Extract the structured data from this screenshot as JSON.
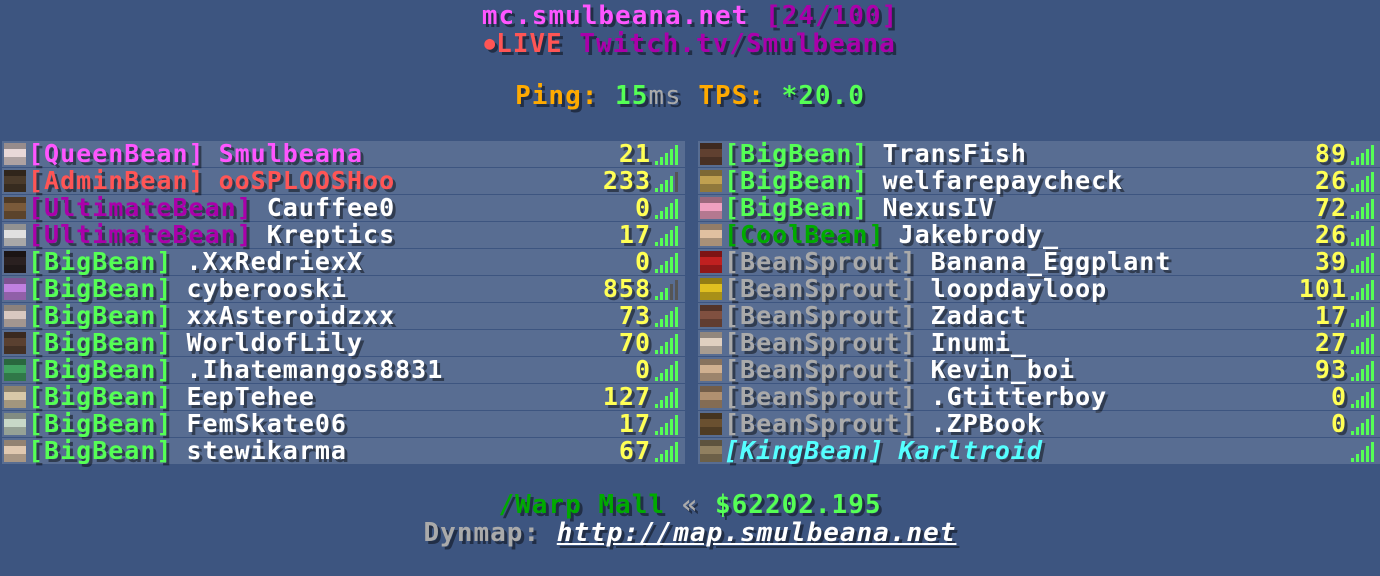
{
  "header": {
    "server": "mc.smulbeana.net",
    "count": "[24/100]",
    "live_dot": "●",
    "live": "LIVE",
    "twitch": "Twitch.tv/Smulbeana",
    "ping_label": "Ping:",
    "ping_value": "15",
    "ping_unit": "ms",
    "tps_label": "TPS:",
    "tps_value": "*20.0"
  },
  "colors": {
    "background": "#3d5580",
    "pink": "#ff55ff",
    "purple": "#aa00aa",
    "red": "#ff5555",
    "green": "#55ff55",
    "darkgreen": "#00aa00",
    "gray": "#aaaaaa",
    "aqua": "#55ffff",
    "gold": "#ffaa00",
    "yellow": "#ffff55"
  },
  "players_left": [
    {
      "rank": "[QueenBean]",
      "name": "Smulbeana",
      "ping": "21",
      "rank_color": "#ff55ff",
      "name_color": "#ff55ff",
      "head": "#e8d8d8",
      "signal": "full"
    },
    {
      "rank": "[AdminBean]",
      "name": "ooSPLOOSHoo",
      "ping": "233",
      "rank_color": "#ff5555",
      "name_color": "#ff5555",
      "head": "#4a3a2a",
      "signal": "weak2"
    },
    {
      "rank": "[UltimateBean]",
      "name": "Cauffee0",
      "ping": "0",
      "rank_color": "#aa00aa",
      "name_color": "#ffffff",
      "head": "#7a5a3a",
      "signal": "full"
    },
    {
      "rank": "[UltimateBean]",
      "name": "Kreptics",
      "ping": "17",
      "rank_color": "#aa00aa",
      "name_color": "#ffffff",
      "head": "#e0e0e0",
      "signal": "full"
    },
    {
      "rank": "[BigBean]",
      "name": ".XxRedriexX",
      "ping": "0",
      "rank_color": "#55ff55",
      "name_color": "#ffffff",
      "head": "#2a2020",
      "signal": "full"
    },
    {
      "rank": "[BigBean]",
      "name": "cyberooski",
      "ping": "858",
      "rank_color": "#55ff55",
      "name_color": "#ffffff",
      "head": "#c080e0",
      "signal": "weak"
    },
    {
      "rank": "[BigBean]",
      "name": "xxAsteroidzxx",
      "ping": "73",
      "rank_color": "#55ff55",
      "name_color": "#ffffff",
      "head": "#d8c8c0",
      "signal": "full"
    },
    {
      "rank": "[BigBean]",
      "name": "WorldofLily",
      "ping": "70",
      "rank_color": "#55ff55",
      "name_color": "#ffffff",
      "head": "#5a4030",
      "signal": "full"
    },
    {
      "rank": "[BigBean]",
      "name": ".Ihatemangos8831",
      "ping": "0",
      "rank_color": "#55ff55",
      "name_color": "#ffffff",
      "head": "#40a060",
      "signal": "full"
    },
    {
      "rank": "[BigBean]",
      "name": "EepTehee",
      "ping": "127",
      "rank_color": "#55ff55",
      "name_color": "#ffffff",
      "head": "#d8c8a8",
      "signal": "full"
    },
    {
      "rank": "[BigBean]",
      "name": "FemSkate06",
      "ping": "17",
      "rank_color": "#55ff55",
      "name_color": "#ffffff",
      "head": "#c8d8c8",
      "signal": "full"
    },
    {
      "rank": "[BigBean]",
      "name": "stewikarma",
      "ping": "67",
      "rank_color": "#55ff55",
      "name_color": "#ffffff",
      "head": "#e0c8b0",
      "signal": "full"
    }
  ],
  "players_right": [
    {
      "rank": "[BigBean]",
      "name": "TransFish",
      "ping": "89",
      "rank_color": "#55ff55",
      "name_color": "#ffffff",
      "head": "#604030",
      "signal": "full"
    },
    {
      "rank": "[BigBean]",
      "name": "welfarepaycheck",
      "ping": "26",
      "rank_color": "#55ff55",
      "name_color": "#ffffff",
      "head": "#c0a050",
      "signal": "full"
    },
    {
      "rank": "[BigBean]",
      "name": "NexusIV",
      "ping": "72",
      "rank_color": "#55ff55",
      "name_color": "#ffffff",
      "head": "#f0a0c0",
      "signal": "full"
    },
    {
      "rank": "[CoolBean]",
      "name": "Jakebrody_",
      "ping": "26",
      "rank_color": "#00aa00",
      "name_color": "#ffffff",
      "head": "#e0c0a0",
      "signal": "full"
    },
    {
      "rank": "[BeanSprout]",
      "name": "Banana_Eggplant",
      "ping": "39",
      "rank_color": "#aaaaaa",
      "name_color": "#ffffff",
      "head": "#c02020",
      "signal": "full"
    },
    {
      "rank": "[BeanSprout]",
      "name": "loopdayloop",
      "ping": "101",
      "rank_color": "#aaaaaa",
      "name_color": "#ffffff",
      "head": "#e0c020",
      "signal": "full"
    },
    {
      "rank": "[BeanSprout]",
      "name": "Zadact",
      "ping": "17",
      "rank_color": "#aaaaaa",
      "name_color": "#ffffff",
      "head": "#805040",
      "signal": "full"
    },
    {
      "rank": "[BeanSprout]",
      "name": "Inumi_",
      "ping": "27",
      "rank_color": "#aaaaaa",
      "name_color": "#ffffff",
      "head": "#e0d0c0",
      "signal": "full"
    },
    {
      "rank": "[BeanSprout]",
      "name": "Kevin_boi",
      "ping": "93",
      "rank_color": "#aaaaaa",
      "name_color": "#ffffff",
      "head": "#d0b090",
      "signal": "full"
    },
    {
      "rank": "[BeanSprout]",
      "name": ".Gtitterboy",
      "ping": "0",
      "rank_color": "#aaaaaa",
      "name_color": "#ffffff",
      "head": "#b09070",
      "signal": "full"
    },
    {
      "rank": "[BeanSprout]",
      "name": ".ZPBook",
      "ping": "0",
      "rank_color": "#aaaaaa",
      "name_color": "#ffffff",
      "head": "#6a5030",
      "signal": "full"
    },
    {
      "rank": "[KingBean]",
      "name": "Karltroid",
      "ping": "",
      "rank_color": "#55ffff",
      "name_color": "#55ffff",
      "head": "#908060",
      "signal": "full",
      "italic": true
    }
  ],
  "footer": {
    "warp": "/Warp Mall",
    "arrow": "«",
    "balance": "$62202.195",
    "dynmap_label": "Dynmap:",
    "dynmap_url": "http://map.smulbeana.net"
  }
}
